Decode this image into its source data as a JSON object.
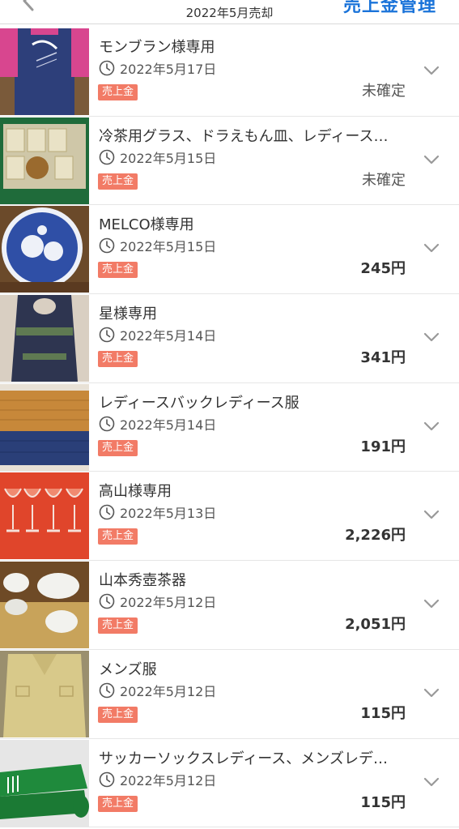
{
  "header": {
    "title": "2022年5月売却",
    "action_label": "売上金管理"
  },
  "items": [
    {
      "title": "モンブラン様専用",
      "date": "2022年5月17日",
      "badge": "売上金",
      "amount": "未確定",
      "pending": true
    },
    {
      "title": "冷茶用グラス、ドラえもん皿、レディース…",
      "date": "2022年5月15日",
      "badge": "売上金",
      "amount": "未確定",
      "pending": true
    },
    {
      "title": "MELCO様専用",
      "date": "2022年5月15日",
      "badge": "売上金",
      "amount": "245円",
      "pending": false
    },
    {
      "title": "星様専用",
      "date": "2022年5月14日",
      "badge": "売上金",
      "amount": "341円",
      "pending": false
    },
    {
      "title": "レディースバックレディース服",
      "date": "2022年5月14日",
      "badge": "売上金",
      "amount": "191円",
      "pending": false
    },
    {
      "title": "高山様専用",
      "date": "2022年5月13日",
      "badge": "売上金",
      "amount": "2,226円",
      "pending": false
    },
    {
      "title": "山本秀壺茶器",
      "date": "2022年5月12日",
      "badge": "売上金",
      "amount": "2,051円",
      "pending": false
    },
    {
      "title": "メンズ服",
      "date": "2022年5月12日",
      "badge": "売上金",
      "amount": "115円",
      "pending": false
    },
    {
      "title": "サッカーソックスレディース、メンズレデ…",
      "date": "2022年5月12日",
      "badge": "売上金",
      "amount": "115円",
      "pending": false
    }
  ],
  "colors": {
    "accent": "#1a73d9",
    "badge": "#f27b66"
  }
}
